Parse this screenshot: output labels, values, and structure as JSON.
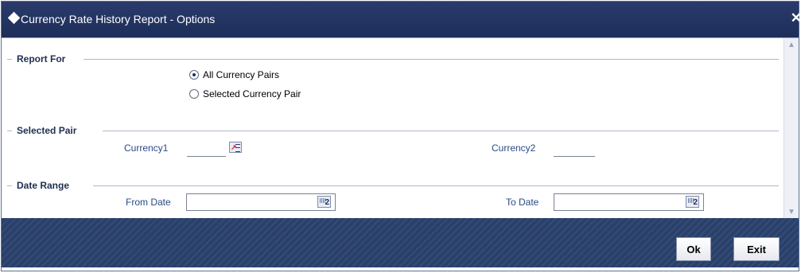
{
  "window": {
    "title": "Currency Rate History Report - Options"
  },
  "sections": {
    "report_for": "Report For",
    "selected_pair": "Selected Pair",
    "date_range": "Date Range"
  },
  "report_for": {
    "options": [
      {
        "label": "All Currency Pairs",
        "selected": true
      },
      {
        "label": "Selected Currency Pair",
        "selected": false
      }
    ]
  },
  "selected_pair": {
    "currency1_label": "Currency1",
    "currency1_value": "",
    "currency2_label": "Currency2",
    "currency2_value": ""
  },
  "date_range": {
    "from_label": "From Date",
    "from_value": "",
    "to_label": "To Date",
    "to_value": ""
  },
  "icons": {
    "calendar_number": "2"
  },
  "footer": {
    "ok_label": "Ok",
    "exit_label": "Exit"
  },
  "colors": {
    "titlebar": "#1e2e5a",
    "footer": "#29406b",
    "label_text": "#2a4a86"
  }
}
